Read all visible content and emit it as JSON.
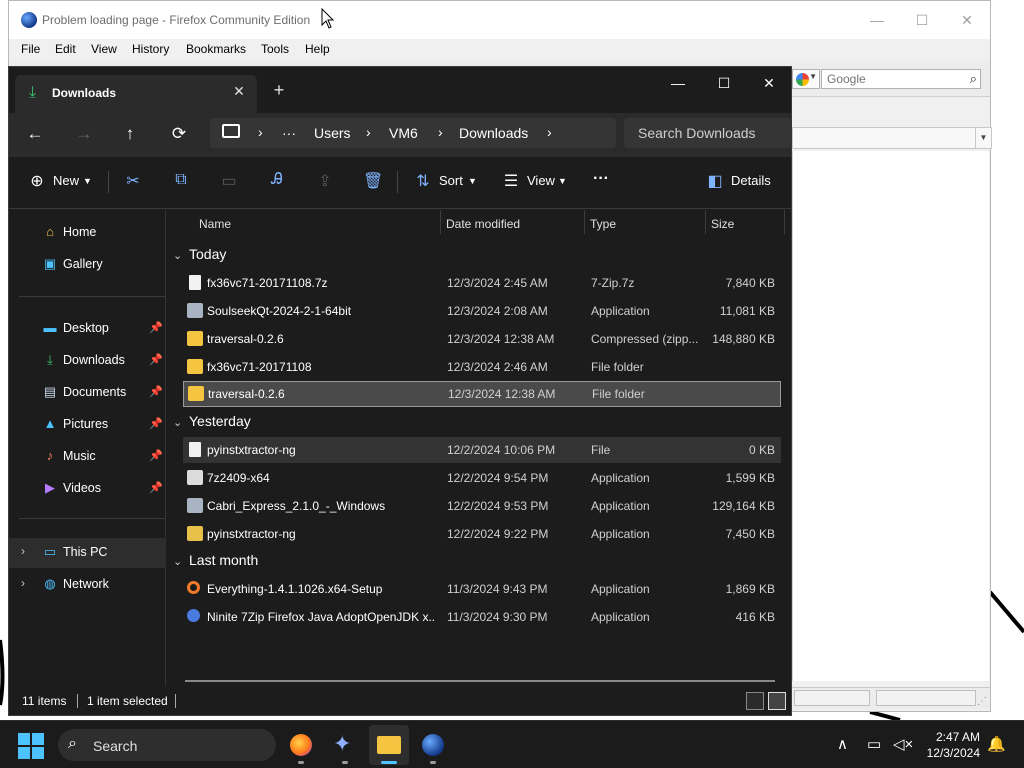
{
  "firefox": {
    "title": "Problem loading page - Firefox Community Edition",
    "controls": {
      "minimize": "—",
      "maximize": "☐",
      "close": "✕"
    },
    "menu": [
      "File",
      "Edit",
      "View",
      "History",
      "Bookmarks",
      "Tools",
      "Help"
    ],
    "search_placeholder": "Google"
  },
  "explorer": {
    "tab_title": "Downloads",
    "tab_close": "✕",
    "new_tab": "+",
    "window_controls": {
      "minimize": "—",
      "maximize": "☐",
      "close": "✕"
    },
    "path": {
      "more": "···",
      "crumbs": [
        "Users",
        "VM6",
        "Downloads"
      ]
    },
    "search_placeholder": "Search Downloads",
    "toolbar": {
      "new": "New",
      "sort": "Sort",
      "view": "View",
      "more": "···",
      "details": "Details"
    },
    "nav": {
      "top": [
        {
          "label": "Home",
          "icon": "home-icon"
        },
        {
          "label": "Gallery",
          "icon": "gallery-icon"
        }
      ],
      "quick_access": [
        {
          "label": "Desktop",
          "icon": "desktop-icon"
        },
        {
          "label": "Downloads",
          "icon": "download-icon"
        },
        {
          "label": "Documents",
          "icon": "documents-icon"
        },
        {
          "label": "Pictures",
          "icon": "pictures-icon"
        },
        {
          "label": "Music",
          "icon": "music-icon"
        },
        {
          "label": "Videos",
          "icon": "videos-icon"
        }
      ],
      "devices": [
        {
          "label": "This PC",
          "icon": "this-pc-icon",
          "selected": true
        },
        {
          "label": "Network",
          "icon": "network-icon"
        }
      ]
    },
    "columns": {
      "name": "Name",
      "date": "Date modified",
      "type": "Type",
      "size": "Size"
    },
    "groups": [
      {
        "label": "Today",
        "rows": [
          {
            "name": "fx36vc71-20171108.7z",
            "date": "12/3/2024 2:45 AM",
            "type": "7-Zip.7z",
            "size": "7,840 KB",
            "icon": "file"
          },
          {
            "name": "SoulseekQt-2024-2-1-64bit",
            "date": "12/3/2024 2:08 AM",
            "type": "Application",
            "size": "11,081 KB",
            "icon": "app"
          },
          {
            "name": "traversal-0.2.6",
            "date": "12/3/2024 12:38 AM",
            "type": "Compressed (zipp...",
            "size": "148,880 KB",
            "icon": "zip"
          },
          {
            "name": "fx36vc71-20171108",
            "date": "12/3/2024 2:46 AM",
            "type": "File folder",
            "size": "",
            "icon": "folder"
          },
          {
            "name": "traversal-0.2.6",
            "date": "12/3/2024 12:38 AM",
            "type": "File folder",
            "size": "",
            "icon": "folder",
            "state": "selected"
          }
        ]
      },
      {
        "label": "Yesterday",
        "rows": [
          {
            "name": "pyinstxtractor-ng",
            "date": "12/2/2024 10:06 PM",
            "type": "File",
            "size": "0 KB",
            "icon": "file",
            "state": "hover"
          },
          {
            "name": "7z2409-x64",
            "date": "12/2/2024 9:54 PM",
            "type": "Application",
            "size": "1,599 KB",
            "icon": "app"
          },
          {
            "name": "Cabri_Express_2.1.0_-_Windows",
            "date": "12/2/2024 9:53 PM",
            "type": "Application",
            "size": "129,164 KB",
            "icon": "app"
          },
          {
            "name": "pyinstxtractor-ng",
            "date": "12/2/2024 9:22 PM",
            "type": "Application",
            "size": "7,450 KB",
            "icon": "app"
          }
        ]
      },
      {
        "label": "Last month",
        "rows": [
          {
            "name": "Everything-1.4.1.1026.x64-Setup",
            "date": "11/3/2024 9:43 PM",
            "type": "Application",
            "size": "1,869 KB",
            "icon": "app"
          },
          {
            "name": "Ninite 7Zip Firefox Java AdoptOpenJDK x...",
            "date": "11/3/2024 9:30 PM",
            "type": "Application",
            "size": "416 KB",
            "icon": "app"
          }
        ]
      }
    ],
    "status": {
      "items": "11 items",
      "selected": "1 item selected"
    }
  },
  "taskbar": {
    "search_label": "Search",
    "apps": [
      "firefox-icon",
      "soulseek-icon",
      "file-explorer-icon",
      "firefox-globe-icon"
    ],
    "time": "2:47 AM",
    "date": "12/3/2024"
  },
  "colors": {
    "accent": "#4cc2ff",
    "folder": "#f5c542",
    "explorer_bg": "#1c1c1c"
  }
}
